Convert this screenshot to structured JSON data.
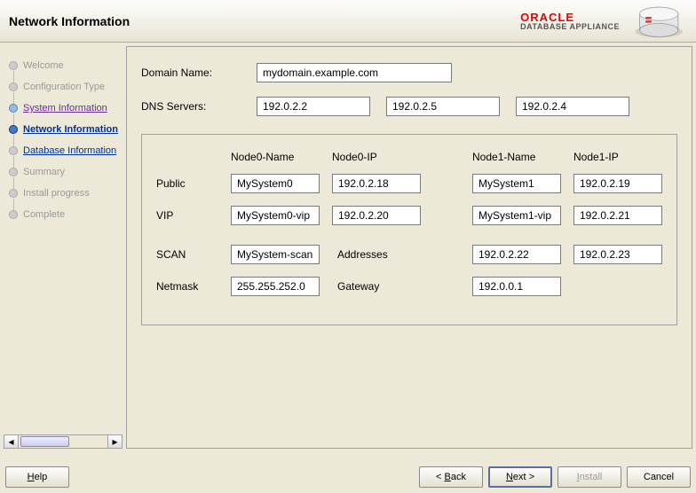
{
  "header": {
    "title": "Network Information",
    "brand_top": "ORACLE",
    "brand_sub": "DATABASE APPLIANCE"
  },
  "nav": {
    "steps": [
      {
        "label": "Welcome",
        "state": "past-disabled"
      },
      {
        "label": "Configuration Type",
        "state": "past-disabled"
      },
      {
        "label": "System Information",
        "state": "done"
      },
      {
        "label": "Network Information",
        "state": "current"
      },
      {
        "label": "Database Information",
        "state": "avail"
      },
      {
        "label": "Summary",
        "state": "future"
      },
      {
        "label": "Install progress",
        "state": "future"
      },
      {
        "label": "Complete",
        "state": "future"
      }
    ]
  },
  "form": {
    "domain_label": "Domain Name:",
    "domain_value": "mydomain.example.com",
    "dns_label": "DNS Servers:",
    "dns": [
      "192.0.2.2",
      "192.0.2.5",
      "192.0.2.4"
    ]
  },
  "grid": {
    "headers": {
      "c1": "Node0-Name",
      "c2": "Node0-IP",
      "c3": "Node1-Name",
      "c4": "Node1-IP"
    },
    "public_label": "Public",
    "public": {
      "n0name": "MySystem0",
      "n0ip": "192.0.2.18",
      "n1name": "MySystem1",
      "n1ip": "192.0.2.19"
    },
    "vip_label": "VIP",
    "vip": {
      "n0name": "MySystem0-vip",
      "n0ip": "192.0.2.20",
      "n1name": "MySystem1-vip",
      "n1ip": "192.0.2.21"
    },
    "scan_label": "SCAN",
    "scan_name": "MySystem-scan",
    "scan_addr_label": "Addresses",
    "scan_a1": "192.0.2.22",
    "scan_a2": "192.0.2.23",
    "netmask_label": "Netmask",
    "netmask": "255.255.252.0",
    "gateway_label": "Gateway",
    "gateway": "192.0.0.1"
  },
  "footer": {
    "help": "Help",
    "back": "Back",
    "next": "Next",
    "install": "Install",
    "cancel": "Cancel"
  }
}
